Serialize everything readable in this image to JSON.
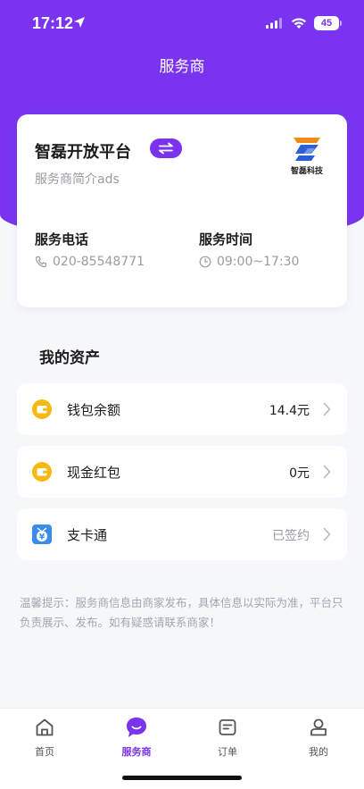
{
  "status_bar": {
    "time": "17:12",
    "battery": "45"
  },
  "header": {
    "title": "服务商"
  },
  "provider": {
    "name": "智磊开放平台",
    "description": "服务商简介ads",
    "logo_text": "智磊科技",
    "phone_label": "服务电话",
    "phone_value": "020-85548771",
    "hours_label": "服务时间",
    "hours_value": "09:00~17:30"
  },
  "assets": {
    "title": "我的资产",
    "items": [
      {
        "label": "钱包余额",
        "value": "14.4元",
        "icon": "wallet-icon"
      },
      {
        "label": "现金红包",
        "value": "0元",
        "icon": "wallet-icon"
      },
      {
        "label": "支卡通",
        "value": "已签约",
        "icon": "yuan-card-icon"
      }
    ]
  },
  "notice": "温馨提示：服务商信息由商家发布，具体信息以实际为准，平台只负责展示、发布。如有疑惑请联系商家！",
  "tabbar": {
    "items": [
      {
        "label": "首页",
        "icon": "home-icon"
      },
      {
        "label": "服务商",
        "icon": "chat-bubble-icon"
      },
      {
        "label": "订单",
        "icon": "order-icon"
      },
      {
        "label": "我的",
        "icon": "user-icon"
      }
    ],
    "active_index": 1
  },
  "colors": {
    "accent": "#7a34f0",
    "coin": "#f6b913",
    "card_icon": "#3b8ce8"
  }
}
